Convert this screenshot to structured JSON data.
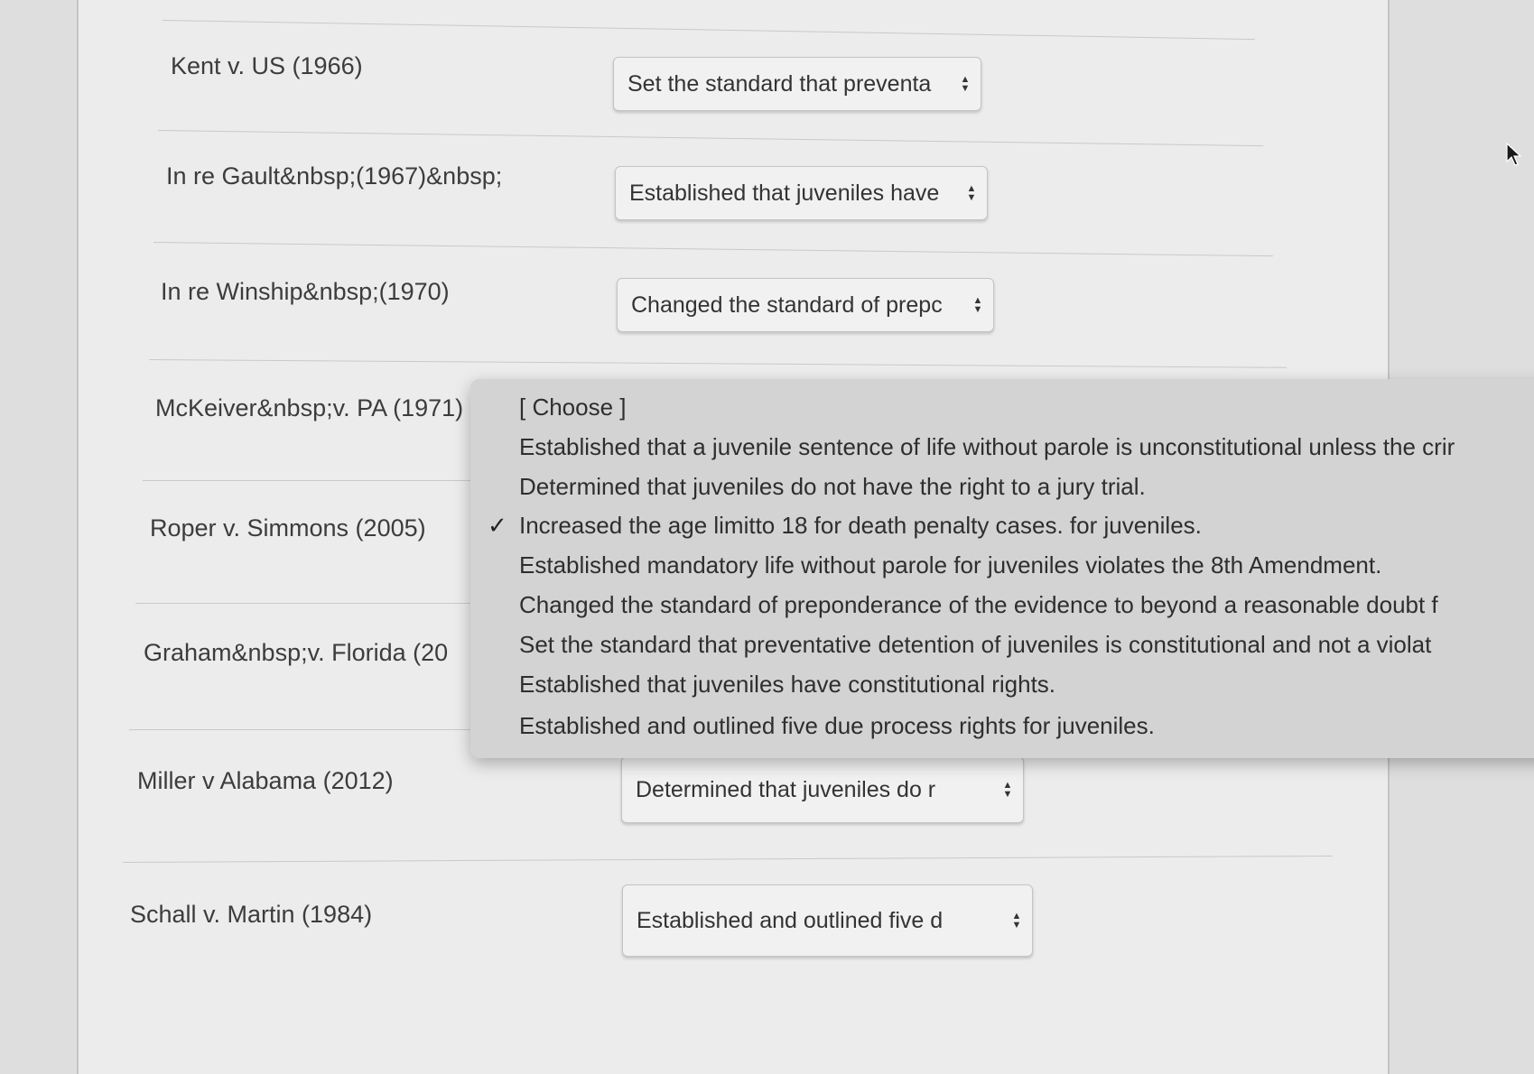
{
  "rows": [
    {
      "case": "Kent v. US (1966)",
      "selected": "Set the standard that preventa"
    },
    {
      "case": "In re Gault&nbsp;(1967)&nbsp;",
      "selected": "Established that juveniles have"
    },
    {
      "case": "In re Winship&nbsp;(1970)",
      "selected": "Changed the standard of prepc"
    },
    {
      "case": "McKeiver&nbsp;v. PA (1971)",
      "selected": ""
    },
    {
      "case": "Roper v. Simmons (2005)",
      "selected": ""
    },
    {
      "case": "Graham&nbsp;v. Florida (20",
      "selected": ""
    },
    {
      "case": "Miller v Alabama (2012)",
      "selected": "Determined that juveniles do r"
    },
    {
      "case": "Schall v. Martin (1984)",
      "selected": "Established and outlined five d"
    }
  ],
  "dropdown": {
    "checkmark": "✓",
    "options": [
      "[ Choose ]",
      "Established that a juvenile sentence of life without parole is unconstitutional unless the crir",
      "Determined that juveniles do not have the right to a jury trial.",
      "Increased the age limitto 18 for death penalty cases. for juveniles.",
      "Established mandatory life without parole for juveniles violates the 8th Amendment.",
      "Changed the standard of preponderance of the evidence to beyond a reasonable doubt f",
      "Set the standard that preventative detention of juveniles is constitutional and not a violat",
      "Established that juveniles have constitutional rights.",
      "Established and outlined five due process rights for juveniles."
    ]
  }
}
